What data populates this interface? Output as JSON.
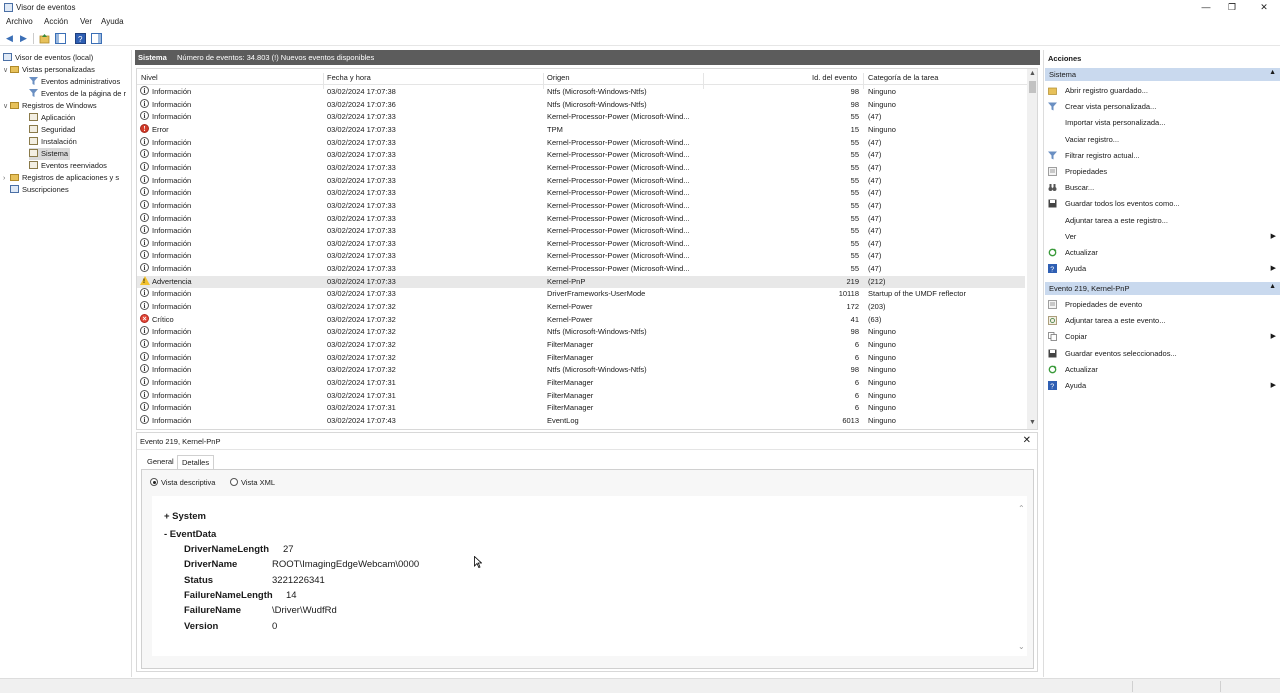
{
  "window": {
    "title": "Visor de eventos",
    "minimize_glyph": "—",
    "restore_glyph": "❐",
    "close_glyph": "✕"
  },
  "menu": [
    "Archivo",
    "Acción",
    "Ver",
    "Ayuda"
  ],
  "tree": {
    "root": "Visor de eventos (local)",
    "custom_views": "Vistas personalizadas",
    "admin_events": "Eventos administrativos",
    "page_events": "Eventos de la página de r",
    "windows_logs": "Registros de Windows",
    "application": "Aplicación",
    "security": "Seguridad",
    "setup": "Instalación",
    "system": "Sistema",
    "forwarded": "Eventos reenviados",
    "app_services": "Registros de aplicaciones y s",
    "subscriptions": "Suscripciones"
  },
  "middle": {
    "log_name": "Sistema",
    "count_text": "Número de eventos: 34.803 (!) Nuevos eventos disponibles"
  },
  "columns": {
    "level": "Nivel",
    "datetime": "Fecha y hora",
    "source": "Origen",
    "event_id": "Id. del evento",
    "category": "Categoría de la tarea"
  },
  "events": [
    {
      "level": "Información",
      "type": "info",
      "datetime": "03/02/2024 17:07:38",
      "source": "Ntfs (Microsoft-Windows-Ntfs)",
      "id": "98",
      "category": "Ninguno"
    },
    {
      "level": "Información",
      "type": "info",
      "datetime": "03/02/2024 17:07:36",
      "source": "Ntfs (Microsoft-Windows-Ntfs)",
      "id": "98",
      "category": "Ninguno"
    },
    {
      "level": "Información",
      "type": "info",
      "datetime": "03/02/2024 17:07:33",
      "source": "Kernel-Processor-Power (Microsoft-Wind...",
      "id": "55",
      "category": "(47)"
    },
    {
      "level": "Error",
      "type": "error",
      "datetime": "03/02/2024 17:07:33",
      "source": "TPM",
      "id": "15",
      "category": "Ninguno"
    },
    {
      "level": "Información",
      "type": "info",
      "datetime": "03/02/2024 17:07:33",
      "source": "Kernel-Processor-Power (Microsoft-Wind...",
      "id": "55",
      "category": "(47)"
    },
    {
      "level": "Información",
      "type": "info",
      "datetime": "03/02/2024 17:07:33",
      "source": "Kernel-Processor-Power (Microsoft-Wind...",
      "id": "55",
      "category": "(47)"
    },
    {
      "level": "Información",
      "type": "info",
      "datetime": "03/02/2024 17:07:33",
      "source": "Kernel-Processor-Power (Microsoft-Wind...",
      "id": "55",
      "category": "(47)"
    },
    {
      "level": "Información",
      "type": "info",
      "datetime": "03/02/2024 17:07:33",
      "source": "Kernel-Processor-Power (Microsoft-Wind...",
      "id": "55",
      "category": "(47)"
    },
    {
      "level": "Información",
      "type": "info",
      "datetime": "03/02/2024 17:07:33",
      "source": "Kernel-Processor-Power (Microsoft-Wind...",
      "id": "55",
      "category": "(47)"
    },
    {
      "level": "Información",
      "type": "info",
      "datetime": "03/02/2024 17:07:33",
      "source": "Kernel-Processor-Power (Microsoft-Wind...",
      "id": "55",
      "category": "(47)"
    },
    {
      "level": "Información",
      "type": "info",
      "datetime": "03/02/2024 17:07:33",
      "source": "Kernel-Processor-Power (Microsoft-Wind...",
      "id": "55",
      "category": "(47)"
    },
    {
      "level": "Información",
      "type": "info",
      "datetime": "03/02/2024 17:07:33",
      "source": "Kernel-Processor-Power (Microsoft-Wind...",
      "id": "55",
      "category": "(47)"
    },
    {
      "level": "Información",
      "type": "info",
      "datetime": "03/02/2024 17:07:33",
      "source": "Kernel-Processor-Power (Microsoft-Wind...",
      "id": "55",
      "category": "(47)"
    },
    {
      "level": "Información",
      "type": "info",
      "datetime": "03/02/2024 17:07:33",
      "source": "Kernel-Processor-Power (Microsoft-Wind...",
      "id": "55",
      "category": "(47)"
    },
    {
      "level": "Información",
      "type": "info",
      "datetime": "03/02/2024 17:07:33",
      "source": "Kernel-Processor-Power (Microsoft-Wind...",
      "id": "55",
      "category": "(47)"
    },
    {
      "level": "Advertencia",
      "type": "warning",
      "datetime": "03/02/2024 17:07:33",
      "source": "Kernel-PnP",
      "id": "219",
      "category": "(212)",
      "selected": true
    },
    {
      "level": "Información",
      "type": "info",
      "datetime": "03/02/2024 17:07:33",
      "source": "DriverFrameworks-UserMode",
      "id": "10118",
      "category": "Startup of the UMDF reflector"
    },
    {
      "level": "Información",
      "type": "info",
      "datetime": "03/02/2024 17:07:32",
      "source": "Kernel-Power",
      "id": "172",
      "category": "(203)"
    },
    {
      "level": "Crítico",
      "type": "critical",
      "datetime": "03/02/2024 17:07:32",
      "source": "Kernel-Power",
      "id": "41",
      "category": "(63)"
    },
    {
      "level": "Información",
      "type": "info",
      "datetime": "03/02/2024 17:07:32",
      "source": "Ntfs (Microsoft-Windows-Ntfs)",
      "id": "98",
      "category": "Ninguno"
    },
    {
      "level": "Información",
      "type": "info",
      "datetime": "03/02/2024 17:07:32",
      "source": "FilterManager",
      "id": "6",
      "category": "Ninguno"
    },
    {
      "level": "Información",
      "type": "info",
      "datetime": "03/02/2024 17:07:32",
      "source": "FilterManager",
      "id": "6",
      "category": "Ninguno"
    },
    {
      "level": "Información",
      "type": "info",
      "datetime": "03/02/2024 17:07:32",
      "source": "Ntfs (Microsoft-Windows-Ntfs)",
      "id": "98",
      "category": "Ninguno"
    },
    {
      "level": "Información",
      "type": "info",
      "datetime": "03/02/2024 17:07:31",
      "source": "FilterManager",
      "id": "6",
      "category": "Ninguno"
    },
    {
      "level": "Información",
      "type": "info",
      "datetime": "03/02/2024 17:07:31",
      "source": "FilterManager",
      "id": "6",
      "category": "Ninguno"
    },
    {
      "level": "Información",
      "type": "info",
      "datetime": "03/02/2024 17:07:31",
      "source": "FilterManager",
      "id": "6",
      "category": "Ninguno"
    },
    {
      "level": "Información",
      "type": "info",
      "datetime": "03/02/2024 17:07:43",
      "source": "EventLog",
      "id": "6013",
      "category": "Ninguno"
    }
  ],
  "detail": {
    "title": "Evento 219, Kernel-PnP",
    "close_glyph": "✕",
    "tabs": [
      "General",
      "Detalles"
    ],
    "active_tab": "Detalles",
    "radio_friendly": "Vista descriptiva",
    "radio_xml": "Vista XML",
    "system_node": "+ System",
    "eventdata_node": "- EventData",
    "fields": [
      {
        "key": "DriverNameLength",
        "value": "27"
      },
      {
        "key": "DriverName",
        "value": "ROOT\\ImagingEdgeWebcam\\0000"
      },
      {
        "key": "Status",
        "value": "3221226341"
      },
      {
        "key": "FailureNameLength",
        "value": "14"
      },
      {
        "key": "FailureName",
        "value": "\\Driver\\WudfRd"
      },
      {
        "key": "Version",
        "value": "0"
      }
    ]
  },
  "actions": {
    "title": "Acciones",
    "section1": "Sistema",
    "items1": [
      {
        "label": "Abrir registro guardado...",
        "icon": "folder-open-icon"
      },
      {
        "label": "Crear vista personalizada...",
        "icon": "filter-icon"
      },
      {
        "label": "Importar vista personalizada...",
        "icon": "none"
      },
      {
        "label": "Vaciar registro...",
        "icon": "none"
      },
      {
        "label": "Filtrar registro actual...",
        "icon": "filter-icon"
      },
      {
        "label": "Propiedades",
        "icon": "properties-icon"
      },
      {
        "label": "Buscar...",
        "icon": "binoculars-icon"
      },
      {
        "label": "Guardar todos los eventos como...",
        "icon": "save-icon"
      },
      {
        "label": "Adjuntar tarea a este registro...",
        "icon": "none"
      },
      {
        "label": "Ver",
        "icon": "none",
        "submenu": true
      },
      {
        "label": "Actualizar",
        "icon": "refresh-icon"
      },
      {
        "label": "Ayuda",
        "icon": "help-icon",
        "submenu": true
      }
    ],
    "section2": "Evento 219, Kernel-PnP",
    "items2": [
      {
        "label": "Propiedades de evento",
        "icon": "properties-icon"
      },
      {
        "label": "Adjuntar tarea a este evento...",
        "icon": "task-icon"
      },
      {
        "label": "Copiar",
        "icon": "copy-icon",
        "submenu": true
      },
      {
        "label": "Guardar eventos seleccionados...",
        "icon": "save-icon"
      },
      {
        "label": "Actualizar",
        "icon": "refresh-icon"
      },
      {
        "label": "Ayuda",
        "icon": "help-icon",
        "submenu": true
      }
    ]
  },
  "colors": {
    "header_bg": "#5c5c5c",
    "section_bg": "#c9d9ee",
    "selected_row": "#e8e8e8"
  }
}
